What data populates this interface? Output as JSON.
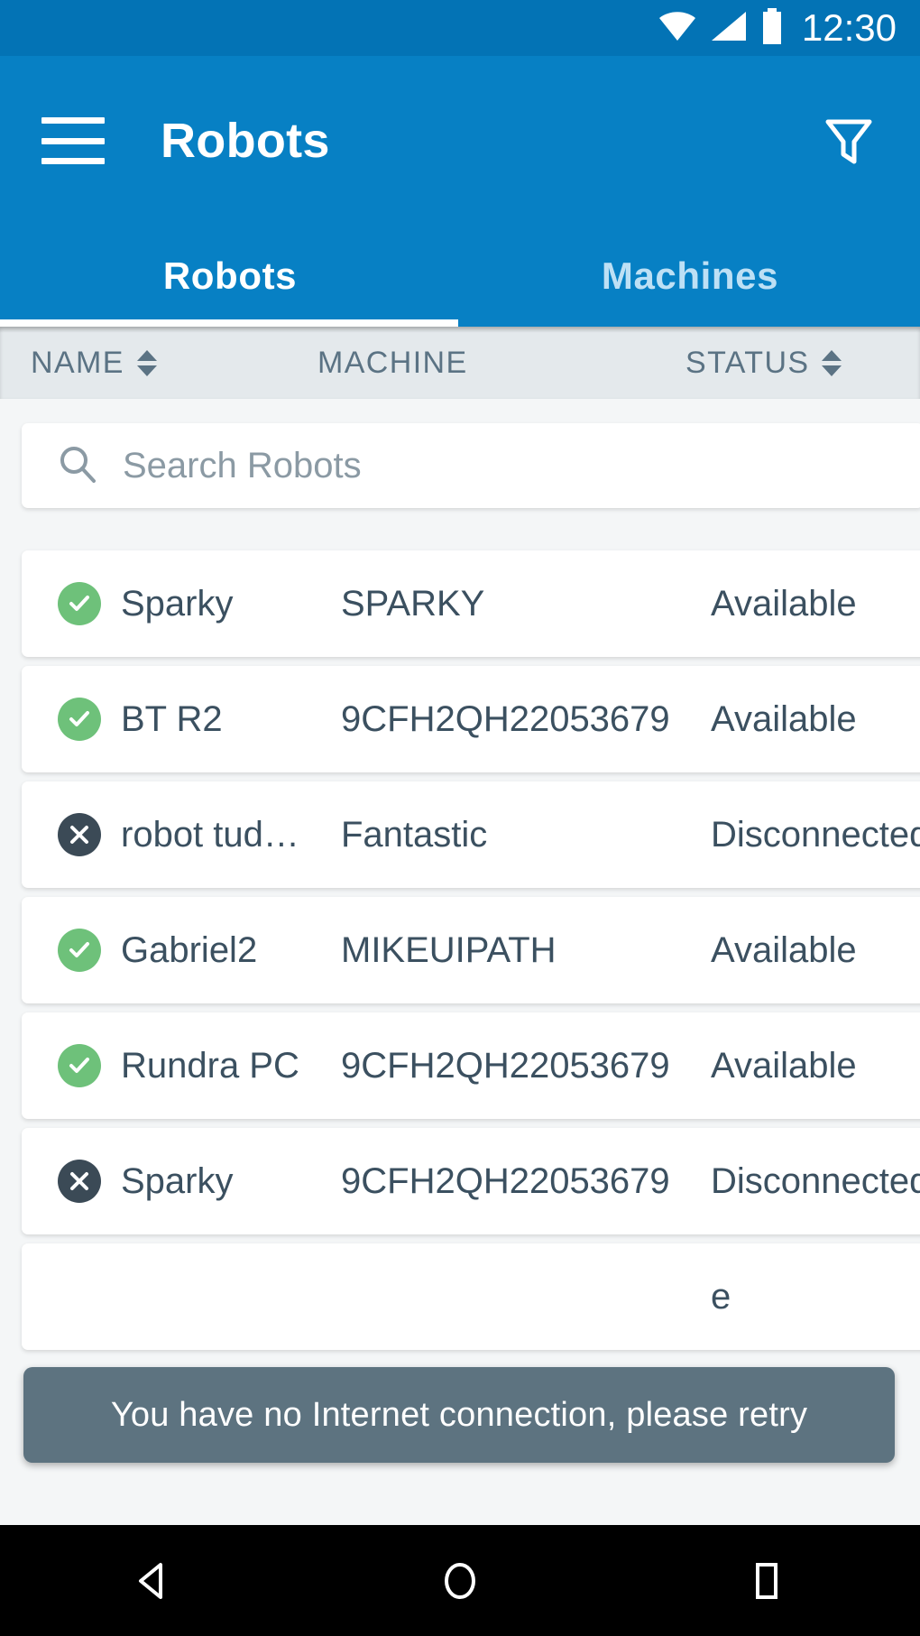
{
  "statusbar": {
    "time": "12:30",
    "icons": [
      "wifi-icon",
      "signal-icon",
      "battery-icon"
    ]
  },
  "appbar": {
    "menu_icon": "hamburger-menu-icon",
    "title": "Robots",
    "filter_icon": "filter-funnel-icon"
  },
  "tabs": {
    "items": [
      {
        "label": "Robots",
        "active": true
      },
      {
        "label": "Machines",
        "active": false
      }
    ]
  },
  "columns": {
    "name": "NAME",
    "machine": "MACHINE",
    "status": "STATUS"
  },
  "search": {
    "placeholder": "Search Robots",
    "value": "",
    "icon": "search-icon"
  },
  "rows": [
    {
      "name": "Sparky",
      "machine": "SPARKY",
      "status": "Available",
      "state": "ok"
    },
    {
      "name": "BT R2",
      "machine": "9CFH2QH22053679",
      "status": "Available",
      "state": "ok"
    },
    {
      "name": "robot tud…",
      "machine": "Fantastic",
      "status": "Disconnected",
      "state": "off"
    },
    {
      "name": "Gabriel2",
      "machine": "MIKEUIPATH",
      "status": "Available",
      "state": "ok"
    },
    {
      "name": "Rundra PC",
      "machine": "9CFH2QH22053679",
      "status": "Available",
      "state": "ok"
    },
    {
      "name": "Sparky",
      "machine": "9CFH2QH22053679",
      "status": "Disconnected",
      "state": "off"
    },
    {
      "name": "",
      "machine": "",
      "status": "e",
      "state": "ok"
    }
  ],
  "toast": {
    "message": "You have no Internet connection, please retry"
  },
  "navbar": {
    "back": "back-triangle-icon",
    "home": "home-circle-icon",
    "recents": "recents-square-icon"
  },
  "colors": {
    "statusbar": "#0373b5",
    "appbar": "#0780c4",
    "available": "#6ec17a",
    "disconnected": "#3b4a56",
    "toast": "#5d7380",
    "page_bg": "#f4f6f7"
  }
}
